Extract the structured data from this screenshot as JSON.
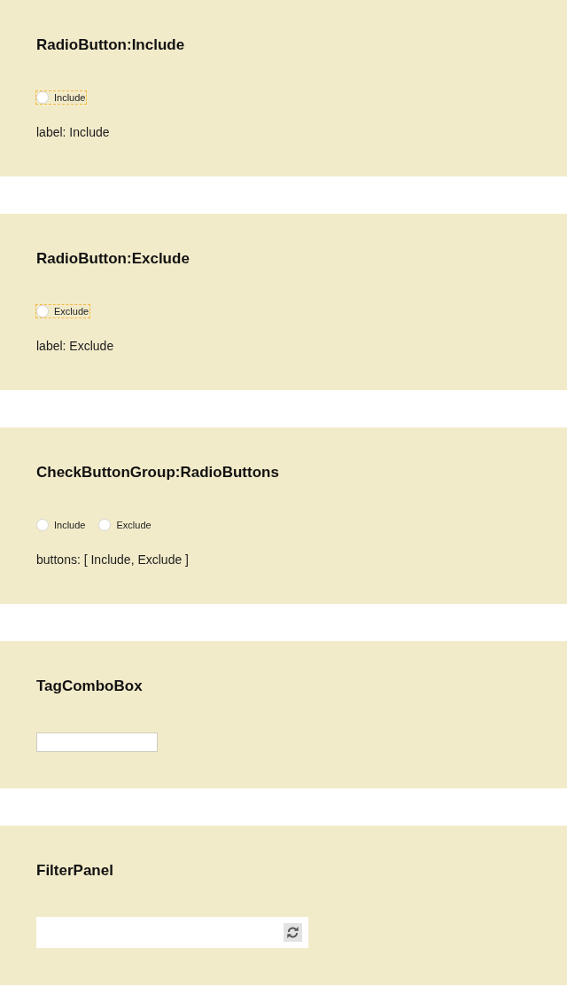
{
  "sections": [
    {
      "kind": "radios",
      "title": "RadioButton:Include",
      "radios": [
        {
          "label": "Include",
          "selected": false,
          "focused": true
        }
      ],
      "caption": "label: Include"
    },
    {
      "kind": "radios",
      "title": "RadioButton:Exclude",
      "radios": [
        {
          "label": "Exclude",
          "selected": false,
          "focused": true
        }
      ],
      "caption": "label: Exclude"
    },
    {
      "kind": "radios",
      "title": "CheckButtonGroup:RadioButtons",
      "radios": [
        {
          "label": "Include",
          "selected": false,
          "focused": false
        },
        {
          "label": "Exclude",
          "selected": false,
          "focused": false
        }
      ],
      "caption": "buttons: [ Include, Exclude ]"
    },
    {
      "kind": "combo",
      "title": "TagComboBox"
    },
    {
      "kind": "filter",
      "title": "FilterPanel"
    }
  ]
}
